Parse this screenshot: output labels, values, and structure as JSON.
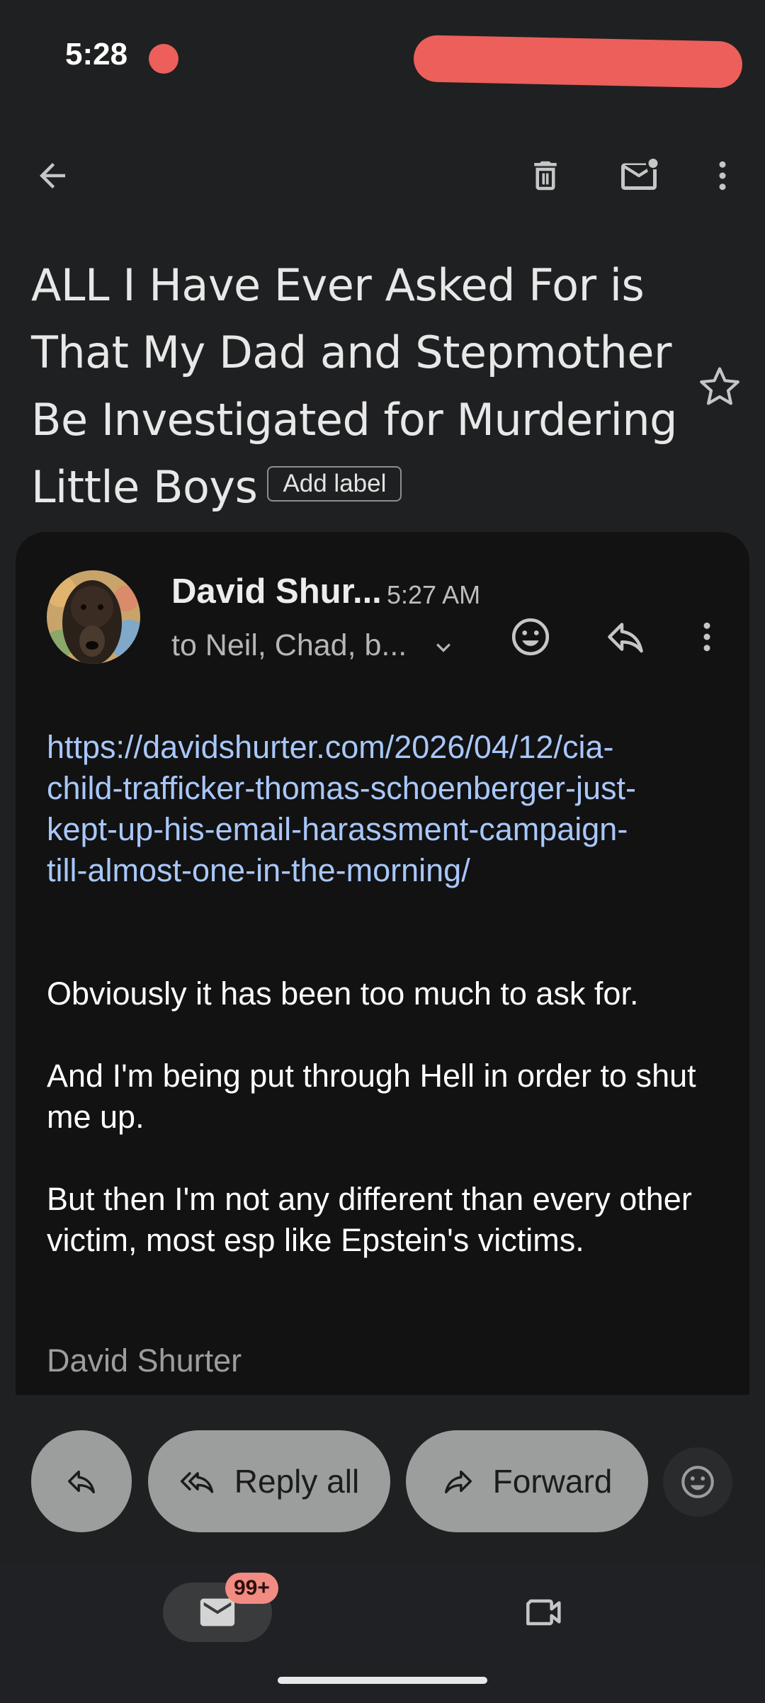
{
  "status_bar": {
    "time": "5:28"
  },
  "colors": {
    "background": "#1f2021",
    "card": "#121212",
    "link": "#a8c7fa",
    "redaction": "#ec5f5a",
    "badge": "#f28b82",
    "action_button": "#9c9e9d"
  },
  "toolbar": {
    "back_icon": "arrow-left-icon",
    "delete_icon": "trash-icon",
    "mark_unread_icon": "mail-unread-icon",
    "more_icon": "more-vertical-icon"
  },
  "email": {
    "subject_lines": [
      "ALL I Have Ever Asked For is",
      "That My Dad and Stepmother",
      "Be Investigated for Murdering",
      "Little Boys"
    ],
    "add_label": "Add label",
    "star_icon": "star-outline-icon",
    "sender": {
      "name": "David Shur...",
      "time": "5:27 AM",
      "to": "to Neil, Chad, b..."
    },
    "body": {
      "link_lines": [
        "https://davidshurter.com/2026/04/12/cia-",
        "child-trafficker-thomas-schoenberger-just-",
        "kept-up-his-email-harassment-campaign-",
        "till-almost-one-in-the-morning/"
      ],
      "paragraphs": [
        "Obviously it has been too much to ask for.",
        "And I'm being put through Hell in order to shut me up.",
        "But then I'm not any different than every other victim, most esp like Epstein's victims."
      ],
      "signature": "David Shurter"
    }
  },
  "actions": {
    "reply_all": "Reply all",
    "forward": "Forward"
  },
  "bottom_nav": {
    "mail_badge": "99+"
  }
}
